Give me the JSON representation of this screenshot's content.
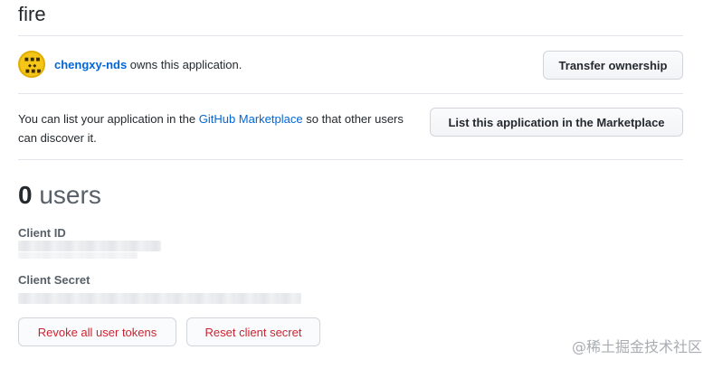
{
  "app": {
    "title": "fire"
  },
  "owner": {
    "username": "chengxy-nds",
    "suffix": " owns this application.",
    "transfer_button": "Transfer ownership"
  },
  "marketplace": {
    "text_before": "You can list your application in the ",
    "link_text": "GitHub Marketplace",
    "text_after": " so that other users can discover it.",
    "list_button": "List this application in the Marketplace"
  },
  "users": {
    "count": "0",
    "label": "users"
  },
  "credentials": {
    "client_id_label": "Client ID",
    "client_secret_label": "Client Secret"
  },
  "actions": {
    "revoke_button": "Revoke all user tokens",
    "reset_button": "Reset client secret"
  },
  "watermark": "@稀土掘金技术社区",
  "colors": {
    "link": "#0366d6",
    "danger": "#cb2431",
    "divider": "#e1e4e8"
  }
}
